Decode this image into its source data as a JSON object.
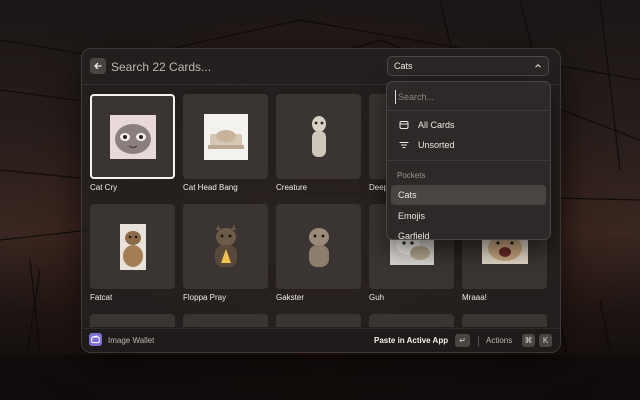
{
  "window": {
    "search_placeholder": "Search 22 Cards...",
    "filter_selected": "Cats"
  },
  "cards": [
    {
      "label": "Cat Cry",
      "selected": true
    },
    {
      "label": "Cat Head Bang"
    },
    {
      "label": "Creature"
    },
    {
      "label": "Deep"
    },
    {
      "label": "Fatcat"
    },
    {
      "label": "Floppa Pray"
    },
    {
      "label": "Gakster"
    },
    {
      "label": "Guh"
    },
    {
      "label": "Mraaa!"
    }
  ],
  "dropdown": {
    "search_placeholder": "Search...",
    "items": [
      {
        "label": "All Cards",
        "icon": "card-icon"
      },
      {
        "label": "Unsorted",
        "icon": "filter-lines-icon"
      }
    ],
    "section_title": "Pockets",
    "pockets": [
      {
        "label": "Cats",
        "active": true
      },
      {
        "label": "Emojis"
      },
      {
        "label": "Garfield"
      }
    ]
  },
  "footer": {
    "title": "Image Wallet",
    "paste_label": "Paste in Active App",
    "enter_key": "↵",
    "actions_label": "Actions",
    "cmd_key": "⌘",
    "k_key": "K"
  },
  "colors": {
    "accent": "#7c6fd6",
    "window_bg": "#24201f",
    "card_bg": "#3a3533"
  }
}
